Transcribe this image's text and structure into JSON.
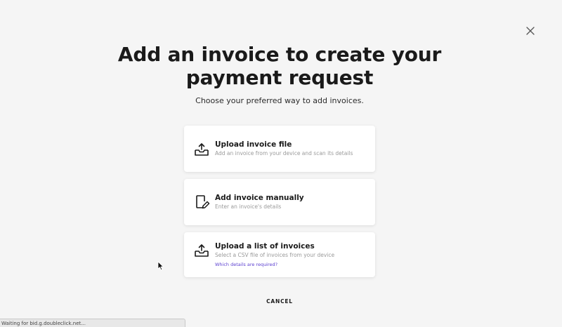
{
  "modal": {
    "title": "Add an invoice to create your payment request",
    "subtitle": "Choose your preferred way to add invoices.",
    "close_icon": "close-icon",
    "options": [
      {
        "icon": "upload-tray-icon",
        "title": "Upload invoice file",
        "description": "Add an invoice from your device and scan its details"
      },
      {
        "icon": "document-edit-icon",
        "title": "Add invoice manually",
        "description": "Enter an invoice's details"
      },
      {
        "icon": "upload-tray-icon",
        "title": "Upload a list of invoices",
        "description": "Select a CSV file of invoices from your device",
        "link": "Which details are required?"
      }
    ],
    "cancel_label": "CANCEL"
  },
  "browser": {
    "status_text": "Waiting for bid.g.doubleclick.net..."
  },
  "colors": {
    "background": "#f5f5f5",
    "card": "#ffffff",
    "text": "#1a1a1a",
    "muted": "#9a9a9a",
    "link": "#5b3fd0"
  }
}
